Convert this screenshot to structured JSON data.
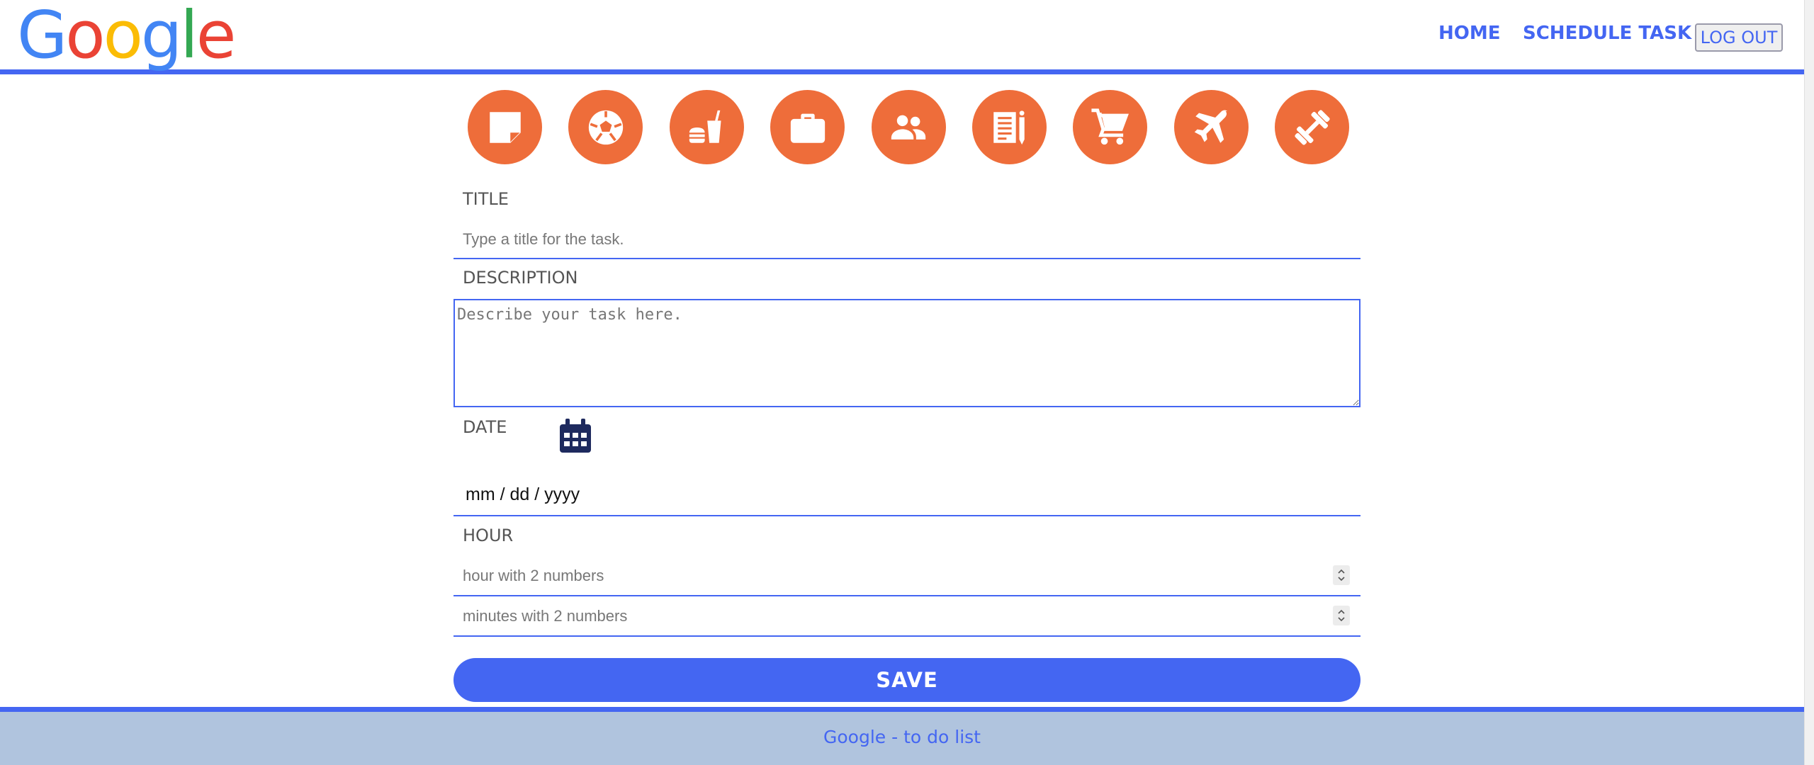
{
  "header": {
    "logo": [
      "G",
      "o",
      "o",
      "g",
      "l",
      "e"
    ],
    "nav": {
      "home": "HOME",
      "schedule": "SCHEDULE TASK",
      "logout": "LOG OUT"
    }
  },
  "categories": [
    {
      "name": "note-icon"
    },
    {
      "name": "soccer-ball-icon"
    },
    {
      "name": "fast-food-icon"
    },
    {
      "name": "briefcase-icon"
    },
    {
      "name": "people-icon"
    },
    {
      "name": "notepad-pencil-icon"
    },
    {
      "name": "shopping-cart-icon"
    },
    {
      "name": "airplane-icon"
    },
    {
      "name": "dumbbell-icon"
    }
  ],
  "form": {
    "title_label": "TITLE",
    "title_placeholder": "Type a title for the task.",
    "description_label": "DESCRIPTION",
    "description_placeholder": "Describe your task here.",
    "date_label": "DATE",
    "date_value": "mm / dd / yyyy",
    "hour_label": "HOUR",
    "hour_placeholder": "hour with 2 numbers",
    "minutes_placeholder": "minutes with 2 numbers",
    "save_label": "SAVE"
  },
  "footer": {
    "text": "Google - to do list"
  },
  "colors": {
    "accent": "#4466f2",
    "category": "#ee6d3a",
    "footer_bg": "#b0c4de",
    "calendar_icon": "#1e2a5e"
  }
}
